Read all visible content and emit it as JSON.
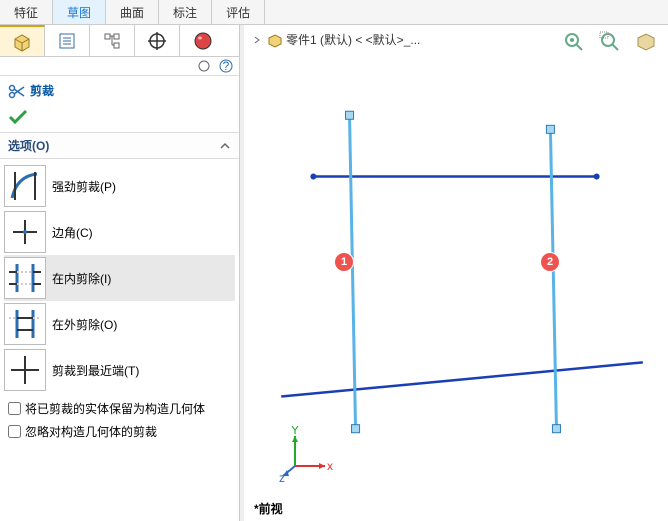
{
  "top_tabs": {
    "features": "特征",
    "sketch": "草图",
    "surface": "曲面",
    "annotation": "标注",
    "evaluate": "评估"
  },
  "command": {
    "title": "剪裁"
  },
  "section": {
    "options": "选项(O)"
  },
  "options": {
    "powerful": "强劲剪裁(P)",
    "corner": "边角(C)",
    "inside": "在内剪除(I)",
    "outside": "在外剪除(O)",
    "closest": "剪裁到最近端(T)"
  },
  "checks": {
    "keep_construction": "将已剪裁的实体保留为构造几何体",
    "ignore_construction": "忽略对构造几何体的剪裁"
  },
  "crumb": {
    "part": "零件1 (默认) < <默认>_..."
  },
  "badges": {
    "b1": "1",
    "b2": "2"
  },
  "axes": {
    "x": "x",
    "y": "Y",
    "z": "z"
  },
  "view_name": "*前视"
}
